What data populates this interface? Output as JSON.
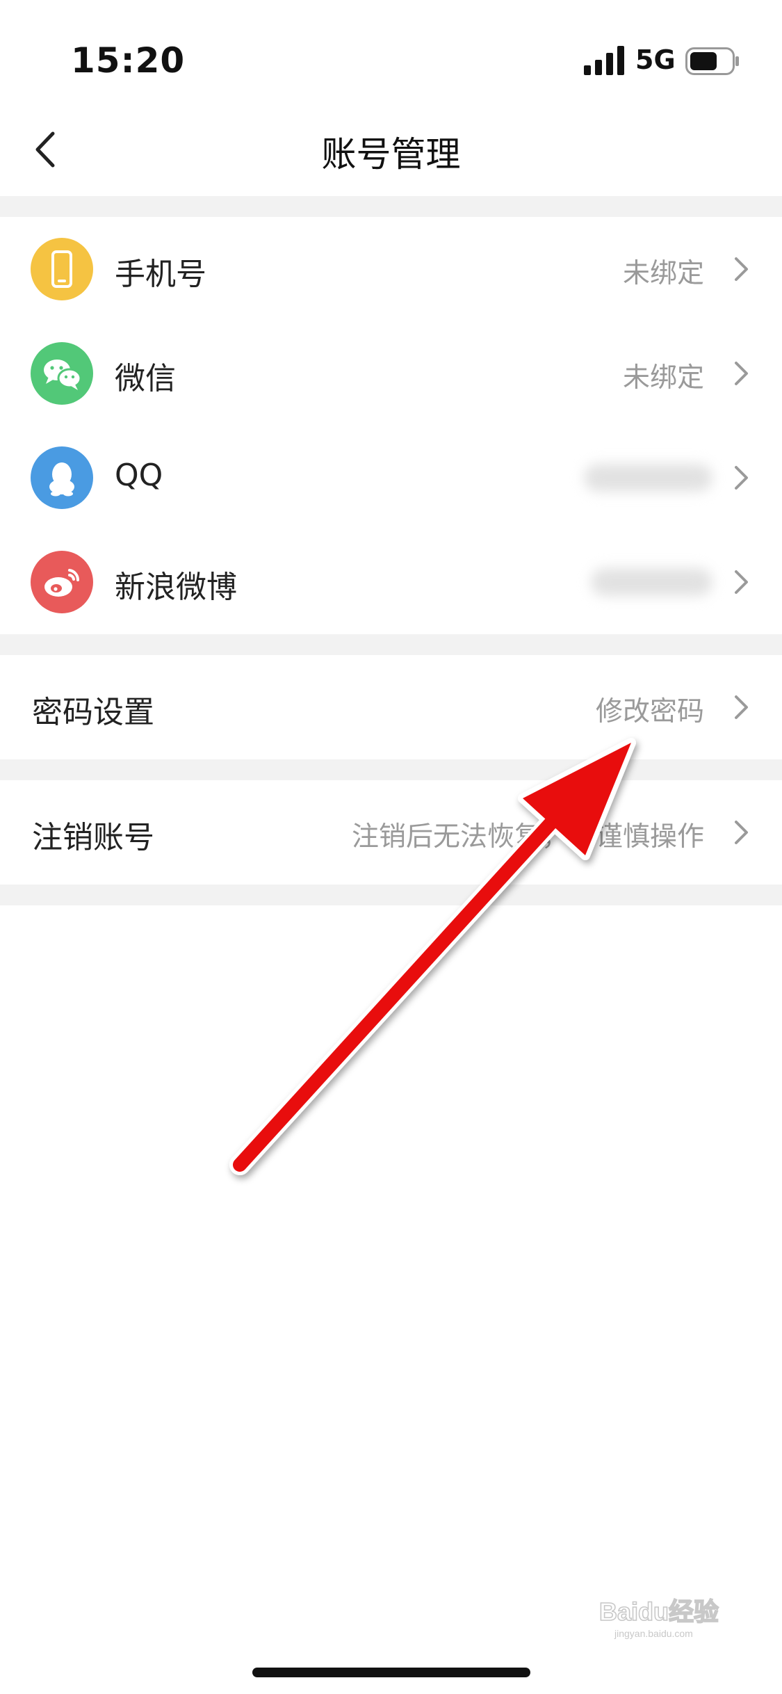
{
  "status_bar": {
    "time": "15:20",
    "network": "5G"
  },
  "header": {
    "title": "账号管理"
  },
  "accounts": [
    {
      "label": "手机号",
      "value": "未绑定",
      "icon": "phone-icon",
      "color": "#f5c342"
    },
    {
      "label": "微信",
      "value": "未绑定",
      "icon": "wechat-icon",
      "color": "#52c878"
    },
    {
      "label": "QQ",
      "value": "",
      "icon": "qq-penguin-icon",
      "color": "#4a9be2"
    },
    {
      "label": "新浪微博",
      "value": "",
      "icon": "weibo-icon",
      "color": "#e85a5a"
    }
  ],
  "password": {
    "label": "密码设置",
    "value": "修改密码"
  },
  "deregister": {
    "label": "注销账号",
    "value": "注销后无法恢复，请谨慎操作"
  },
  "colors": {
    "annotation_arrow": "#e81010",
    "section_gap": "#f2f2f2",
    "secondary_text": "#9a9a9a"
  },
  "watermark": {
    "text": "Baidu经验",
    "subtext": "jingyan.baidu.com"
  }
}
